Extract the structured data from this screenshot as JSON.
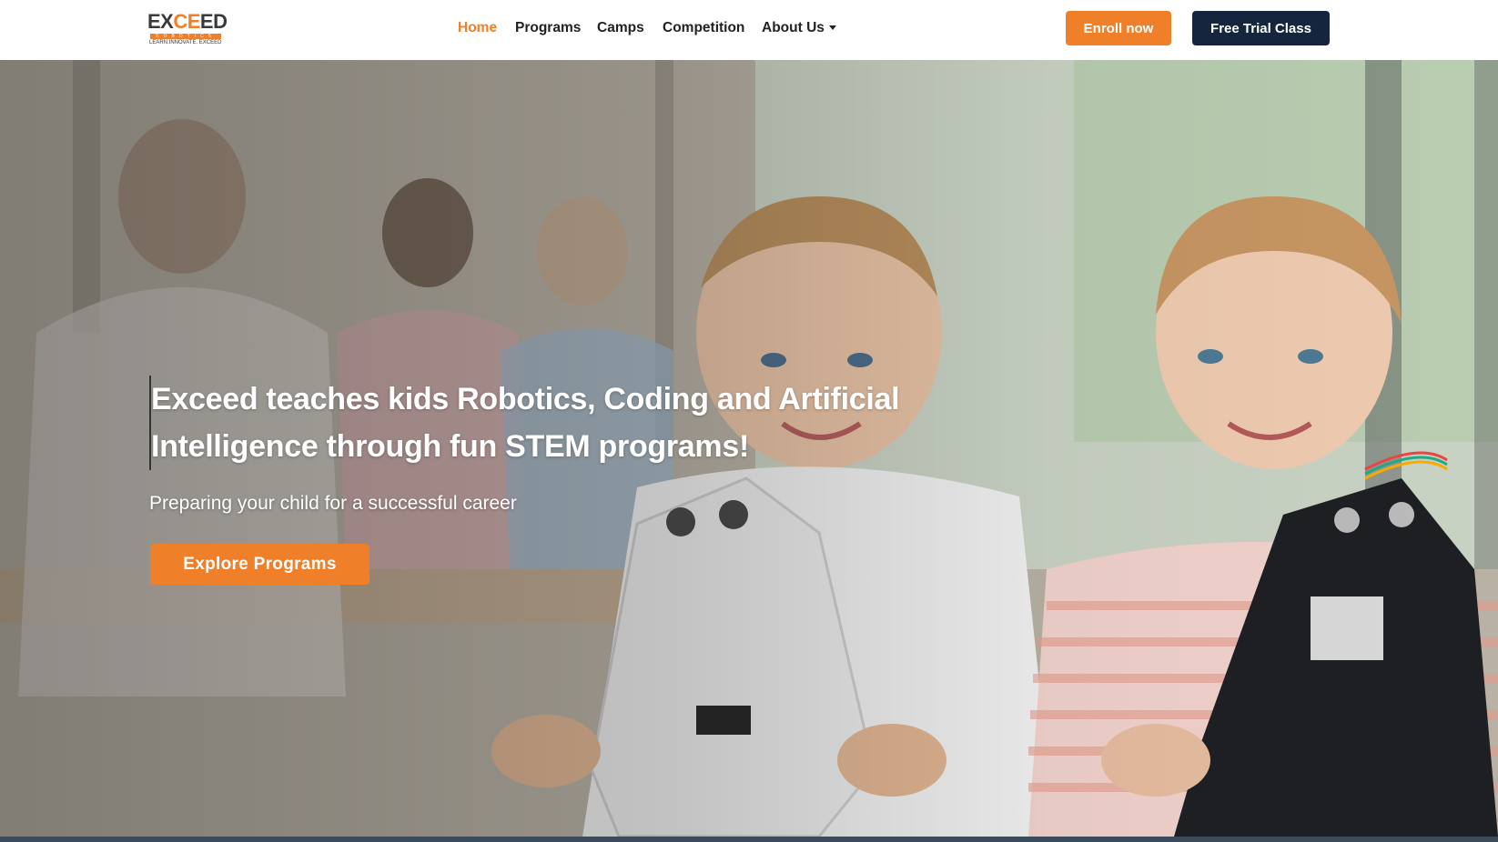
{
  "brand": {
    "name_part1": "EX",
    "name_part2": "CE",
    "name_part3": "ED",
    "sub": "ROBOTICS",
    "tagline": "LEARN.INNOVATE. EXCEED",
    "accent": "#f07f2a",
    "dark": "#14253d"
  },
  "nav": {
    "items": [
      {
        "label": "Home",
        "active": true
      },
      {
        "label": "Programs"
      },
      {
        "label": "Camps"
      },
      {
        "label": "Competition"
      },
      {
        "label": "About Us",
        "dropdown": true
      }
    ]
  },
  "actions": {
    "enroll": "Enroll now",
    "trial": "Free Trial Class"
  },
  "hero": {
    "title": "Exceed teaches kids Robotics, Coding and Artificial Intelligence through fun STEM programs!",
    "subtitle": "Preparing your child for a successful career",
    "cta": "Explore Programs",
    "image_icon": "kids-with-robots-photo"
  }
}
